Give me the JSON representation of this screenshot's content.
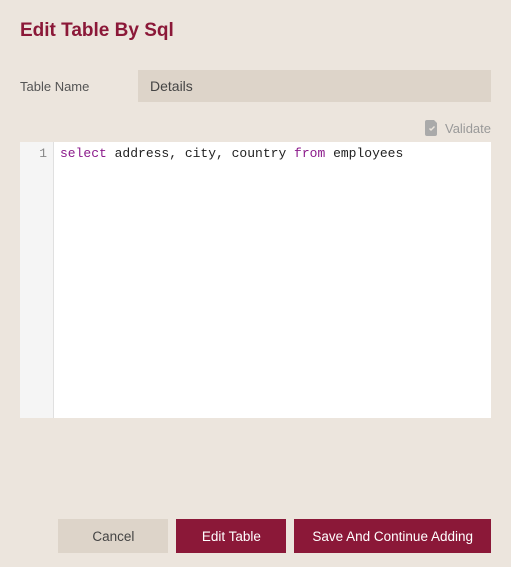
{
  "title": "Edit Table By Sql",
  "tableNameLabel": "Table Name",
  "tableNameValue": "Details",
  "validateLabel": "Validate",
  "editor": {
    "lineNumber": "1",
    "parts": {
      "p1": "select",
      "p2": " address, city, country ",
      "p3": "from",
      "p4": " employees"
    }
  },
  "buttons": {
    "cancel": "Cancel",
    "edit": "Edit Table",
    "saveContinue": "Save And Continue Adding"
  }
}
